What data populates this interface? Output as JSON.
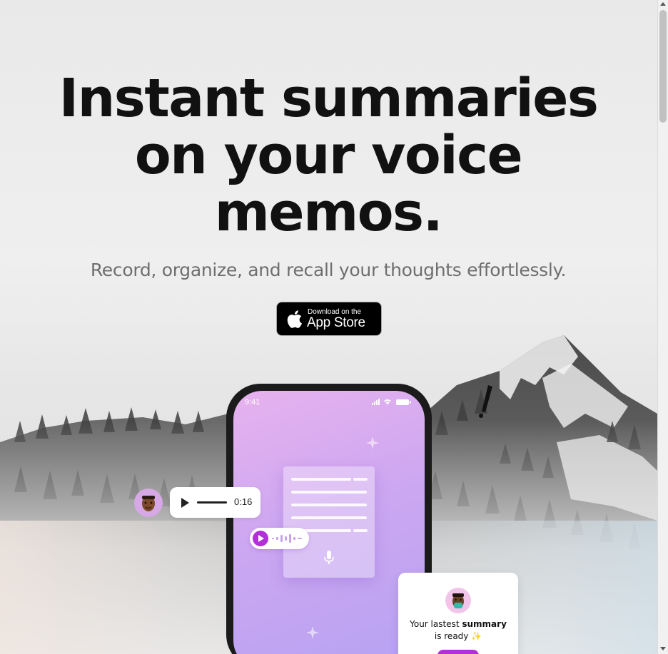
{
  "hero": {
    "title_line1": "Instant summaries",
    "title_line2": "on your voice",
    "title_line3": "memos.",
    "subtitle": "Record, organize, and recall your thoughts effortlessly."
  },
  "app_store_button": {
    "small_text": "Download on the",
    "big_text": "App Store"
  },
  "phone": {
    "status_time": "9:41"
  },
  "audio_message": {
    "duration": "0:16"
  },
  "summary_card": {
    "text_before": "Your lastest",
    "text_bold": "summary",
    "text_after": "is ready ✨"
  },
  "colors": {
    "accent": "#b22fd9",
    "title": "#111111",
    "subtitle": "#6e6e6e",
    "phone_gradient_start": "#e7b2ee",
    "phone_gradient_end": "#b6a2f2"
  },
  "icons": [
    "apple-icon",
    "play-icon",
    "microphone-icon",
    "sparkle-icon",
    "signal-icon",
    "wifi-icon",
    "battery-icon"
  ]
}
